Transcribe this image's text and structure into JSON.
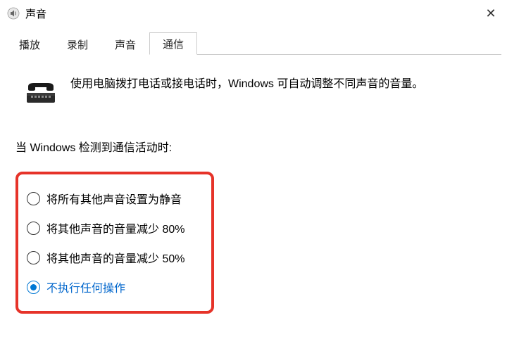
{
  "window": {
    "title": "声音",
    "close_glyph": "✕"
  },
  "tabs": [
    {
      "label": "播放",
      "active": false
    },
    {
      "label": "录制",
      "active": false
    },
    {
      "label": "声音",
      "active": false
    },
    {
      "label": "通信",
      "active": true
    }
  ],
  "content": {
    "intro_text": "使用电脑拨打电话或接电话时，Windows 可自动调整不同声音的音量。",
    "prompt": "当 Windows 检测到通信活动时:",
    "radio_options": [
      {
        "label": "将所有其他声音设置为静音",
        "selected": false
      },
      {
        "label": "将其他声音的音量减少 80%",
        "selected": false
      },
      {
        "label": "将其他声音的音量减少 50%",
        "selected": false
      },
      {
        "label": "不执行任何操作",
        "selected": true
      }
    ]
  },
  "icons": {
    "speaker": "speaker-icon",
    "phone": "phone-icon"
  }
}
